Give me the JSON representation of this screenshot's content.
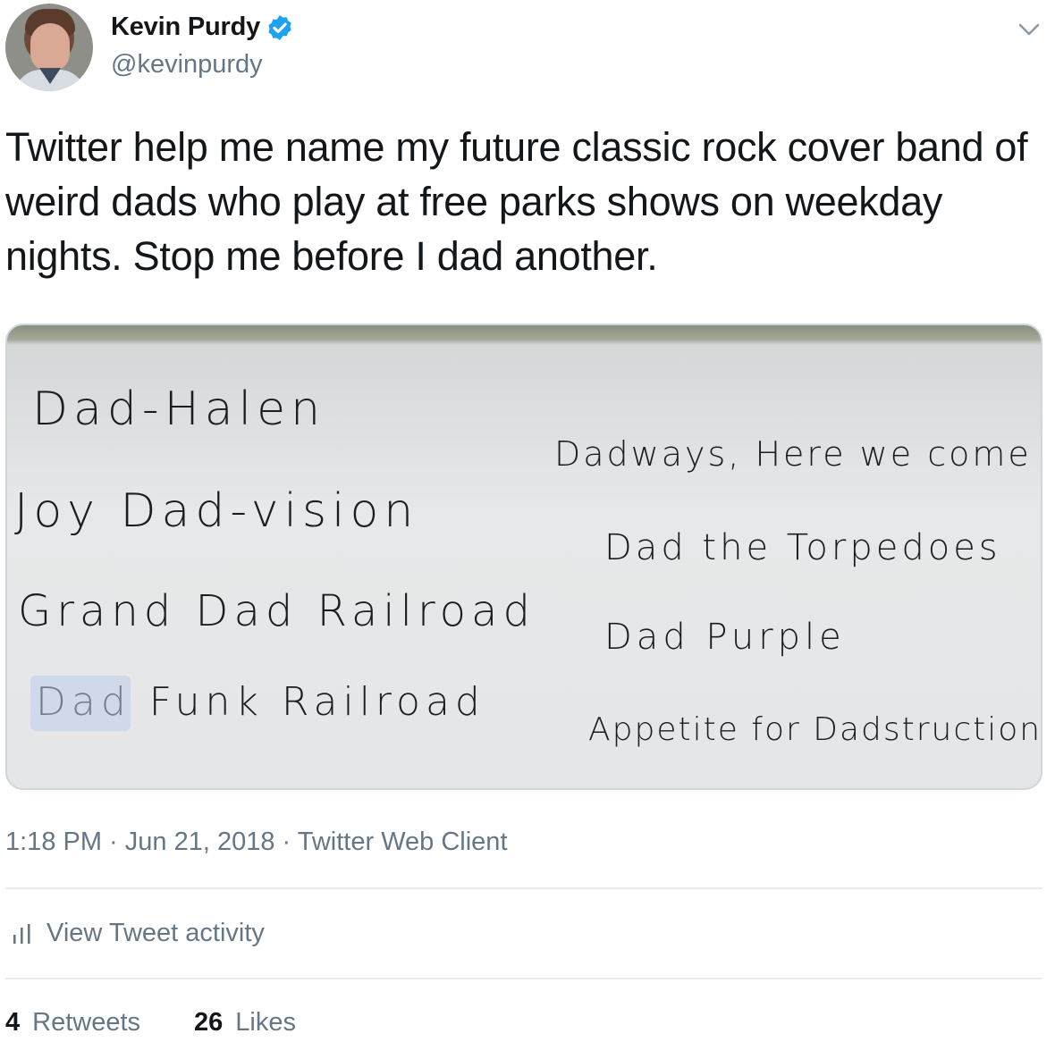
{
  "author": {
    "display_name": "Kevin Purdy",
    "handle": "@kevinpurdy",
    "verified": true,
    "avatar_icon": "user-avatar"
  },
  "tweet": {
    "text": "Twitter help me name my future classic rock cover band of weird dads who play at free parks shows on weekday nights. Stop me before I dad another."
  },
  "media": {
    "whiteboard_left": [
      "Dad-Halen",
      "Joy Dad-vision",
      "Grand Dad Railroad",
      "Dad Funk Railroad"
    ],
    "whiteboard_right": [
      "Dadways, Here we come",
      "Dad the Torpedoes",
      "Dad Purple",
      "Appetite for Dadstruction"
    ]
  },
  "meta": {
    "time": "1:18 PM",
    "separator": " · ",
    "date": "Jun 21, 2018",
    "source": "Twitter Web Client"
  },
  "activity": {
    "label": "View Tweet activity",
    "icon": "bar-chart-icon"
  },
  "stats": {
    "retweets_count": "4",
    "retweets_label": "Retweets",
    "likes_count": "26",
    "likes_label": "Likes"
  },
  "colors": {
    "verified": "#1da1f2",
    "secondary_text": "#657786",
    "primary_text": "#14171a"
  }
}
